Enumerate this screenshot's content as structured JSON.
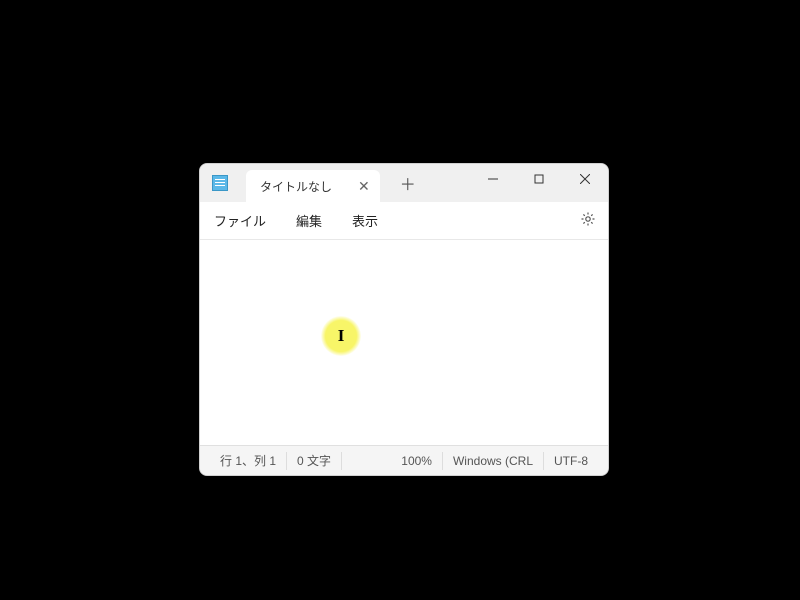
{
  "tab": {
    "title": "タイトルなし"
  },
  "menu": {
    "file": "ファイル",
    "edit": "編集",
    "view": "表示"
  },
  "status": {
    "position": "行 1、列 1",
    "chars": "0 文字",
    "zoom": "100%",
    "lineEnding": "Windows (CRL",
    "encoding": "UTF-8"
  }
}
